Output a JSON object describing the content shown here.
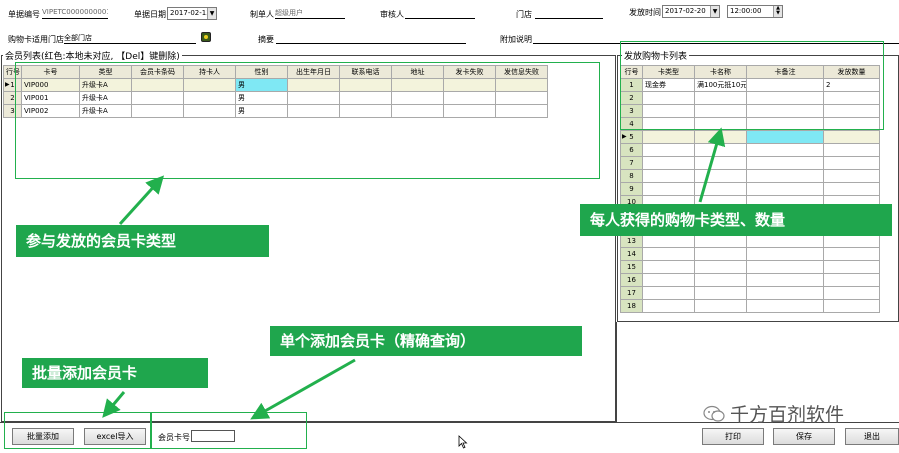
{
  "header": {
    "doc_no_label": "单据编号",
    "doc_no_value": "VIPETC0000000001",
    "doc_date_label": "单据日期",
    "doc_date_value": "2017-02-13",
    "creator_label": "制单人",
    "creator_value": "超级用户",
    "auditor_label": "审核人",
    "auditor_value": "",
    "store_label": "门店",
    "store_value": "",
    "issue_time_label": "发放时间",
    "issue_date_value": "2017-02-20",
    "issue_time_value": "12:00:00",
    "card_store_label": "购物卡适用门店",
    "card_store_value": "全部门店",
    "summary_label": "摘要",
    "summary_value": "",
    "note_label": "附加说明",
    "note_value": ""
  },
  "member_list": {
    "title": "会员列表(红色:本地未对应, 【Del】键删除)",
    "columns": [
      "行号",
      "卡号",
      "类型",
      "会员卡条码",
      "持卡人",
      "性别",
      "出生年月日",
      "联系电话",
      "地址",
      "发卡失败",
      "发信息失败"
    ],
    "rows": [
      [
        "1",
        "VIP000",
        "升级卡A",
        "",
        "",
        "男",
        "",
        "",
        "",
        "",
        ""
      ],
      [
        "2",
        "VIP001",
        "升级卡A",
        "",
        "",
        "男",
        "",
        "",
        "",
        "",
        ""
      ],
      [
        "3",
        "VIP002",
        "升级卡A",
        "",
        "",
        "男",
        "",
        "",
        "",
        "",
        ""
      ]
    ]
  },
  "card_list": {
    "title": "发放购物卡列表",
    "columns": [
      "行号",
      "卡类型",
      "卡名称",
      "卡备注",
      "发放数量"
    ],
    "rows": [
      [
        "1",
        "现金券",
        "满100元抵10元",
        "",
        "2"
      ],
      [
        "2",
        "",
        "",
        "",
        ""
      ],
      [
        "3",
        "",
        "",
        "",
        ""
      ],
      [
        "4",
        "",
        "",
        "",
        ""
      ],
      [
        "5",
        "",
        "",
        "",
        ""
      ],
      [
        "6",
        "",
        "",
        "",
        ""
      ],
      [
        "7",
        "",
        "",
        "",
        ""
      ],
      [
        "8",
        "",
        "",
        "",
        ""
      ],
      [
        "9",
        "",
        "",
        "",
        ""
      ],
      [
        "10",
        "",
        "",
        "",
        ""
      ],
      [
        "11",
        "",
        "",
        "",
        ""
      ],
      [
        "12",
        "",
        "",
        "",
        ""
      ],
      [
        "13",
        "",
        "",
        "",
        ""
      ],
      [
        "14",
        "",
        "",
        "",
        ""
      ],
      [
        "15",
        "",
        "",
        "",
        ""
      ],
      [
        "16",
        "",
        "",
        "",
        ""
      ],
      [
        "17",
        "",
        "",
        "",
        ""
      ],
      [
        "18",
        "",
        "",
        "",
        ""
      ]
    ]
  },
  "bottom": {
    "batch_add_label": "批量添加",
    "excel_import_label": "excel导入",
    "member_card_no_label": "会员卡号",
    "member_card_no_value": "",
    "print_label": "打印",
    "save_label": "保存",
    "exit_label": "退出"
  },
  "annotations": {
    "member_types": "参与发放的会员卡类型",
    "card_types": "每人获得的购物卡类型、数量",
    "single_add": "单个添加会员卡（精确查询）",
    "batch_add": "批量添加会员卡",
    "watermark": "千方百剂软件"
  },
  "colors": {
    "callout_green": "#1fa64d",
    "highlight_cyan": "#7fe8f4",
    "header_gray": "#ece9d8"
  },
  "icons": [
    "dropdown-arrow-icon",
    "spin-icon",
    "store-picker-icon",
    "row-pointer-icon",
    "mouse-cursor-icon",
    "wechat-icon"
  ]
}
